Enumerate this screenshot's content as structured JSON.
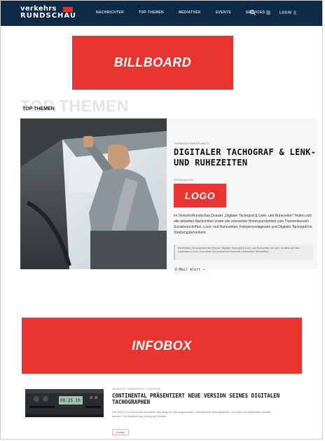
{
  "header": {
    "logo_top": "verkehrs",
    "logo_bottom": "RUNDSCHAU",
    "nav": [
      "NACHRICHTEN",
      "TOP-THEMEN",
      "MEDIATHEK",
      "EVENTS",
      "SERVICES"
    ],
    "login": "LOGIN",
    "colors": {
      "background": "#0e2a47",
      "accent": "#e0302a"
    },
    "icons": [
      "search-icon",
      "menu-icon",
      "user-icon"
    ]
  },
  "placeholders": {
    "billboard": "BILLBOARD",
    "logo": "LOGO",
    "infobox": "INFOBOX",
    "color": "#e9342f"
  },
  "top_themen": {
    "ghost": "TOP THEMEN",
    "title": "TOP THEMEN"
  },
  "featured": {
    "kicker": "THEMENSCHWERPUNKTE",
    "headline": "DIGITALER TACHOGRAF & LENK- UND RUHEZEITEN",
    "sponsored": "SPONSORED BY",
    "body": "Im VerkehrsRundschau Dossier „Digitaler Tachograf & Lenk- und Ruhezeiten\" finden sich alle aktuellen Nachrichten sowie alle relevanten Hintergrundartikel zum Themenbereich Sozialvorschriften, Lenk- und Ruhezeiten, Fahrpersonalgesetz und Digitaler Tachograf im Straßengüterverkehr.",
    "notice": "Bestimmten Sie kostenfrei den Themen 'Digitaler Tachograf & Lenk- und Ruhezeiten' am alert, um stets auf dem Laufenden zu sein. Dies dürfen Sie jederzeit im Newsletter abbestellen (Newsletter).",
    "email_alert": "E-Mail Alert",
    "arrow": "→"
  },
  "second_article": {
    "meta": "28.06.2017 TRANSPORT + LOGISTIK",
    "title": "CONTINENTAL PRÄSENTIERT NEUE VERSION SEINES DIGITALEN TACHOGRAPHEN",
    "text": "Der DTCO 3.0 ebnet laut Hersteller den Weg für den sogenannten „intelligenten Tachographen\" und kann ab September bestellt werden. Die Auslieferung erfolgt ab Oktober.",
    "button": "Details",
    "device_display": "08:25 1h 25"
  }
}
